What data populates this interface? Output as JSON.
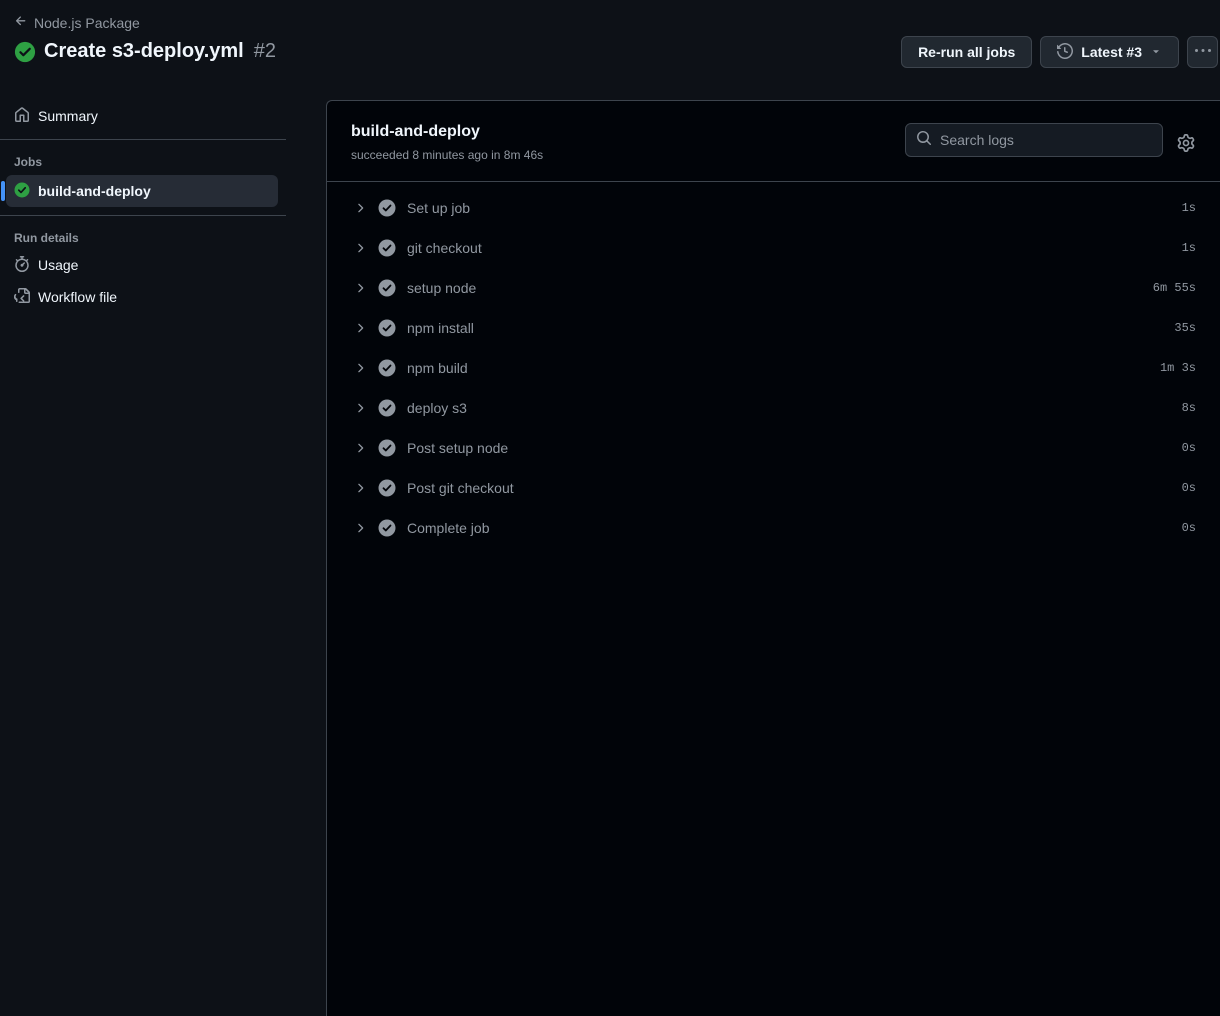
{
  "header": {
    "back_label": "Node.js Package",
    "title": "Create s3-deploy.yml",
    "run_number": "#2",
    "rerun_label": "Re-run all jobs",
    "attempt_label": "Latest #3",
    "colors": {
      "success": "#2ea043",
      "accent": "#4493f8"
    }
  },
  "sidebar": {
    "summary_label": "Summary",
    "jobs_heading": "Jobs",
    "jobs": [
      {
        "label": "build-and-deploy",
        "status": "success"
      }
    ],
    "run_details_heading": "Run details",
    "details": [
      {
        "label": "Usage",
        "icon": "stopwatch-icon"
      },
      {
        "label": "Workflow file",
        "icon": "file-code-icon"
      }
    ]
  },
  "main": {
    "job_title": "build-and-deploy",
    "job_subtitle": "succeeded 8 minutes ago in 8m 46s",
    "search_placeholder": "Search logs",
    "steps": [
      {
        "name": "Set up job",
        "duration": "1s"
      },
      {
        "name": "git checkout",
        "duration": "1s"
      },
      {
        "name": "setup node",
        "duration": "6m 55s"
      },
      {
        "name": "npm install",
        "duration": "35s"
      },
      {
        "name": "npm build",
        "duration": "1m 3s"
      },
      {
        "name": "deploy s3",
        "duration": "8s"
      },
      {
        "name": "Post setup node",
        "duration": "0s"
      },
      {
        "name": "Post git checkout",
        "duration": "0s"
      },
      {
        "name": "Complete job",
        "duration": "0s"
      }
    ]
  }
}
